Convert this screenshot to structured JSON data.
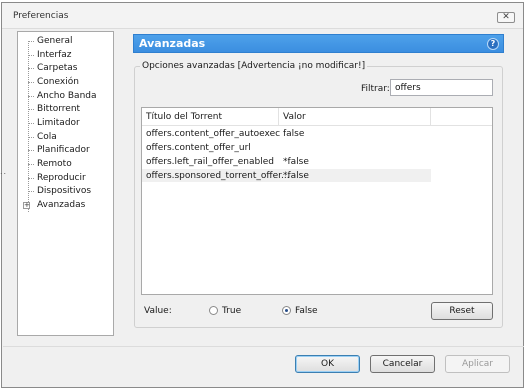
{
  "window": {
    "title": "Preferencias",
    "close_glyph": "✕"
  },
  "side_marker": "..",
  "tree": {
    "items": [
      {
        "label": "General"
      },
      {
        "label": "Interfaz"
      },
      {
        "label": "Carpetas"
      },
      {
        "label": "Conexión"
      },
      {
        "label": "Ancho Banda"
      },
      {
        "label": "Bittorrent"
      },
      {
        "label": "Limitador"
      },
      {
        "label": "Cola"
      },
      {
        "label": "Planificador"
      },
      {
        "label": "Remoto"
      },
      {
        "label": "Reproducir"
      },
      {
        "label": "Dispositivos"
      },
      {
        "label": "Avanzadas",
        "expandable": true,
        "expander_glyph": "+"
      }
    ]
  },
  "panel": {
    "title": "Avanzadas",
    "help_glyph": "?",
    "group_title": "Opciones avanzadas [Advertencia ¡no modificar!]",
    "filter": {
      "label": "Filtrar:",
      "value": "offers"
    },
    "table": {
      "columns": [
        "Título del Torrent",
        "Valor"
      ],
      "rows": [
        {
          "name": "offers.content_offer_autoexec",
          "value": "false",
          "selected": false
        },
        {
          "name": "offers.content_offer_url",
          "value": "",
          "selected": false
        },
        {
          "name": "offers.left_rail_offer_enabled",
          "value": "*false",
          "selected": false
        },
        {
          "name": "offers.sponsored_torrent_offer...",
          "value": "*false",
          "selected": true
        }
      ]
    },
    "value_label": "Value:",
    "radios": [
      {
        "label": "True",
        "checked": false
      },
      {
        "label": "False",
        "checked": true
      }
    ],
    "reset_label": "Reset"
  },
  "footer": {
    "ok_label": "OK",
    "cancel_label": "Cancelar",
    "apply_label": "Aplicar"
  },
  "colors": {
    "header_blue": "#3b8ee0",
    "selected_row": "#f0f0f0"
  }
}
